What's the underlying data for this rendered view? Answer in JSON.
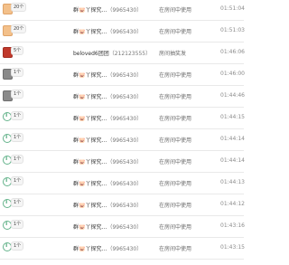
{
  "rows": [
    {
      "avatar": "pig-icon",
      "level": "20个",
      "name": "群🐷丫探究…",
      "id": "（9965430）",
      "status": "在房间中使用",
      "time": "01:51:04"
    },
    {
      "avatar": "pig-icon",
      "level": "20个",
      "name": "群🐷丫探究…",
      "id": "（9965430）",
      "status": "在房间中使用",
      "time": "01:51:03"
    },
    {
      "avatar": "red-box-icon",
      "level": "5个",
      "name": "beloved6团团",
      "id": "（212123555）",
      "status": "房间抽奖发",
      "time": "01:46:06"
    },
    {
      "avatar": "box-icon",
      "level": "1个",
      "name": "群🐷丫探究…",
      "id": "（9965430）",
      "status": "在房间中使用",
      "time": "01:46:00"
    },
    {
      "avatar": "box-icon",
      "level": "1个",
      "name": "群🐷丫探究…",
      "id": "（9965430）",
      "status": "在房间中使用",
      "time": "01:44:46"
    },
    {
      "avatar": "info-icon",
      "level": "1个",
      "name": "群🐷丫探究…",
      "id": "（9965430）",
      "status": "在房间中使用",
      "time": "01:44:15"
    },
    {
      "avatar": "info-icon",
      "level": "1个",
      "name": "群🐷丫探究…",
      "id": "（9965430）",
      "status": "在房间中使用",
      "time": "01:44:14"
    },
    {
      "avatar": "info-icon",
      "level": "1个",
      "name": "群🐷丫探究…",
      "id": "（9965430）",
      "status": "在房间中使用",
      "time": "01:44:14"
    },
    {
      "avatar": "info-icon",
      "level": "1个",
      "name": "群🐷丫探究…",
      "id": "（9965430）",
      "status": "在房间中使用",
      "time": "01:44:13"
    },
    {
      "avatar": "info-icon",
      "level": "1个",
      "name": "群🐷丫探究…",
      "id": "（9965430）",
      "status": "在房间中使用",
      "time": "01:44:12"
    },
    {
      "avatar": "info-icon",
      "level": "1个",
      "name": "群🐷丫探究…",
      "id": "（9965430）",
      "status": "在房间中使用",
      "time": "01:43:16"
    },
    {
      "avatar": "info-icon",
      "level": "1个",
      "name": "群🐷丫探究…",
      "id": "（9965430）",
      "status": "在房间中使用",
      "time": "01:43:15"
    }
  ]
}
